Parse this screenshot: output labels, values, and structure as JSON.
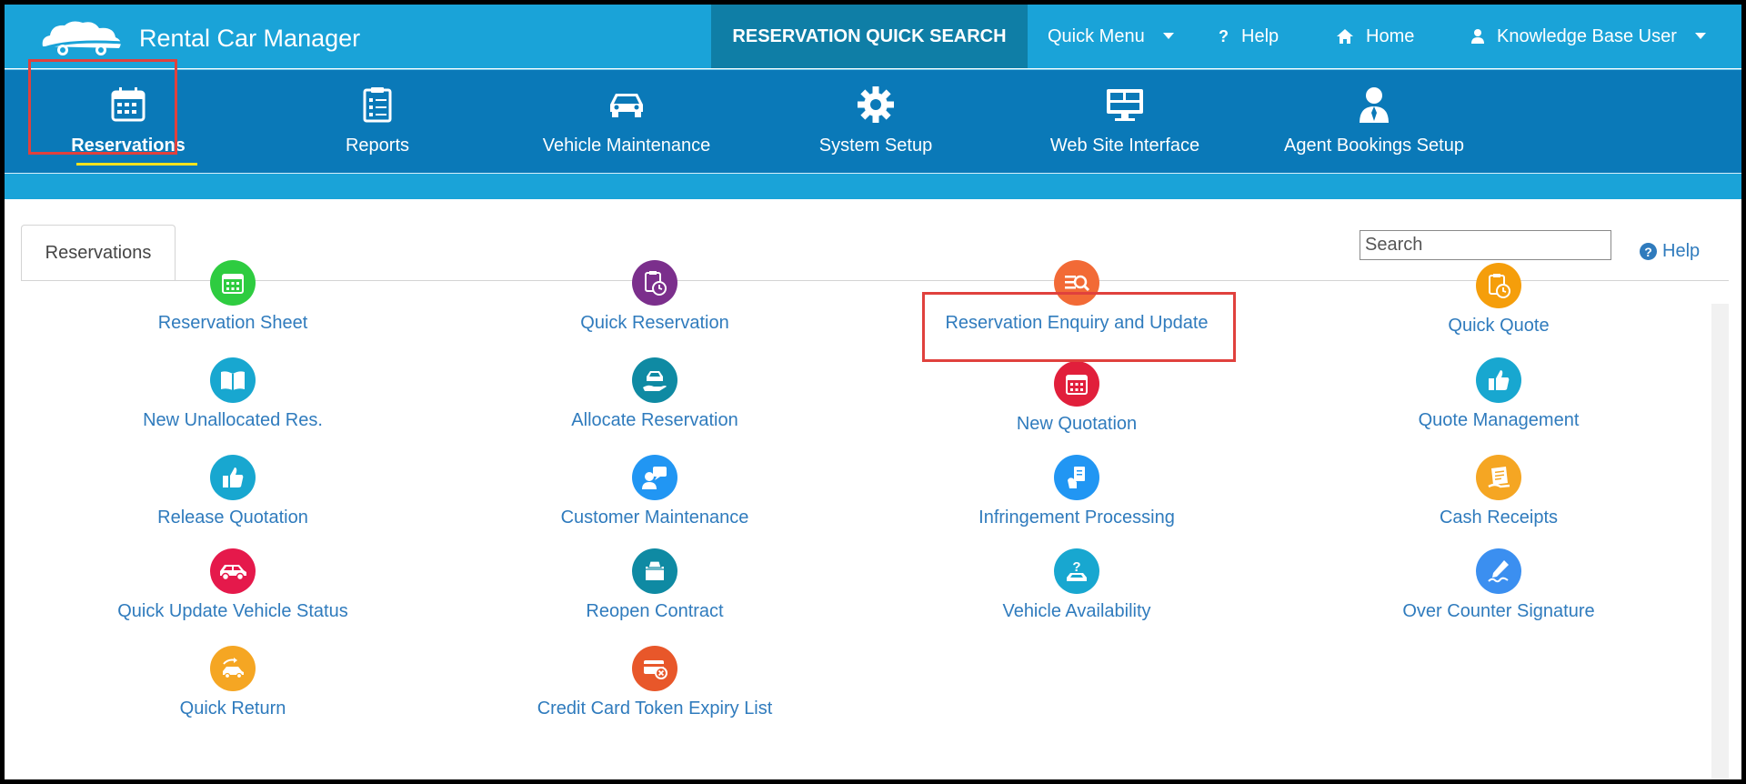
{
  "app": {
    "title": "Rental Car Manager"
  },
  "top_nav": {
    "quick_search": "RESERVATION QUICK SEARCH",
    "quick_menu": "Quick Menu",
    "help": "Help",
    "home": "Home",
    "user": "Knowledge Base User"
  },
  "modules": [
    {
      "label": "Reservations",
      "icon": "calendar-icon",
      "active": true
    },
    {
      "label": "Reports",
      "icon": "clipboard-list-icon"
    },
    {
      "label": "Vehicle Maintenance",
      "icon": "car-icon"
    },
    {
      "label": "System Setup",
      "icon": "gear-icon"
    },
    {
      "label": "Web Site Interface",
      "icon": "monitor-icon"
    },
    {
      "label": "Agent Bookings Setup",
      "icon": "agent-icon"
    }
  ],
  "page": {
    "tab": "Reservations",
    "search_placeholder": "Search",
    "help": "Help"
  },
  "menu": [
    [
      {
        "label": "Reservation Sheet",
        "icon": "calendar-icon",
        "color": "#2ecc40"
      },
      {
        "label": "New Unallocated Res.",
        "icon": "book-icon",
        "color": "#18a7d0"
      },
      {
        "label": "Release Quotation",
        "icon": "thumbs-up-icon",
        "color": "#18a7d0"
      },
      {
        "label": "Quick Update Vehicle Status",
        "icon": "car-icon",
        "color": "#e5194b"
      },
      {
        "label": "Quick Return",
        "icon": "car-return-icon",
        "color": "#f5a623"
      }
    ],
    [
      {
        "label": "Quick Reservation",
        "icon": "clipboard-clock-icon",
        "color": "#7b2f8c"
      },
      {
        "label": "Allocate Reservation",
        "icon": "car-hand-icon",
        "color": "#0f8aa3"
      },
      {
        "label": "Customer Maintenance",
        "icon": "chat-user-icon",
        "color": "#2196f3"
      },
      {
        "label": "Reopen Contract",
        "icon": "folder-open-icon",
        "color": "#0f8aa3"
      },
      {
        "label": "Credit Card Token Expiry List",
        "icon": "credit-card-cancel-icon",
        "color": "#e8572a"
      }
    ],
    [
      {
        "label": "Reservation Enquiry and Update",
        "icon": "list-search-icon",
        "color": "#f26a36"
      },
      {
        "label": "New Quotation",
        "icon": "calendar-icon",
        "color": "#e11f3b"
      },
      {
        "label": "Infringement Processing",
        "icon": "hand-document-icon",
        "color": "#2196f3"
      },
      {
        "label": "Vehicle Availability",
        "icon": "question-car-icon",
        "color": "#18a7d0"
      }
    ],
    [
      {
        "label": "Quick Quote",
        "icon": "clipboard-clock-icon",
        "color": "#f59e0b"
      },
      {
        "label": "Quote Management",
        "icon": "thumbs-up-icon",
        "color": "#18a7d0"
      },
      {
        "label": "Cash Receipts",
        "icon": "receipt-icon",
        "color": "#f5a623"
      },
      {
        "label": "Over Counter Signature",
        "icon": "signature-pen-icon",
        "color": "#3b8ff0"
      }
    ]
  ]
}
